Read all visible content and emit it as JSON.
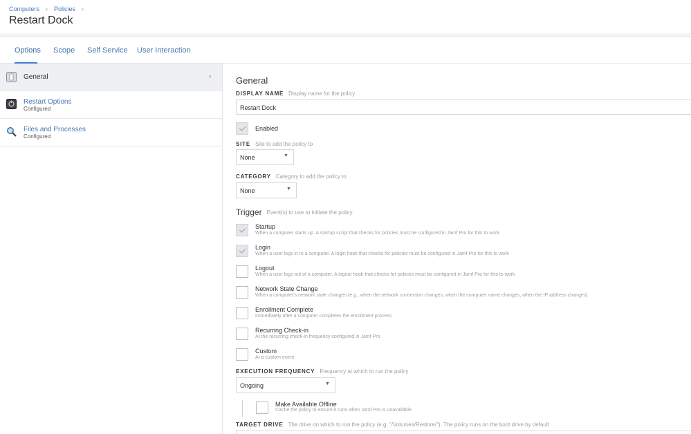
{
  "breadcrumb": [
    "Computers",
    "Policies"
  ],
  "page_title": "Restart Dock",
  "tabs": [
    "Options",
    "Scope",
    "Self Service",
    "User Interaction"
  ],
  "sidebar": {
    "items": [
      {
        "label": "General",
        "sub": ""
      },
      {
        "label": "Restart Options",
        "sub": "Configured"
      },
      {
        "label": "Files and Processes",
        "sub": "Configured"
      }
    ]
  },
  "general": {
    "heading": "General",
    "display_name_label": "DISPLAY NAME",
    "display_name_hint": "Display name for the policy",
    "display_name_value": "Restart Dock",
    "enabled_label": "Enabled",
    "site_label": "SITE",
    "site_hint": "Site to add the policy to",
    "site_value": "None",
    "category_label": "CATEGORY",
    "category_hint": "Category to add the policy to",
    "category_value": "None"
  },
  "trigger": {
    "heading": "Trigger",
    "hint": "Event(s) to use to initiate the policy",
    "items": [
      {
        "label": "Startup",
        "desc": "When a computer starts up. A startup script that checks for policies must be configured in Jamf Pro for this to work",
        "checked": true
      },
      {
        "label": "Login",
        "desc": "When a user logs in to a computer. A login hook that checks for policies must be configured in Jamf Pro for this to work",
        "checked": true
      },
      {
        "label": "Logout",
        "desc": "When a user logs out of a computer. A logout hook that checks for policies must be configured in Jamf Pro for this to work",
        "checked": false
      },
      {
        "label": "Network State Change",
        "desc": "When a computer's network state changes (e.g., when the network connection changes, when the computer name changes, when the IP address changes)",
        "checked": false
      },
      {
        "label": "Enrollment Complete",
        "desc": "Immediately after a computer completes the enrollment process",
        "checked": false
      },
      {
        "label": "Recurring Check-in",
        "desc": "At the recurring check-in frequency configured in Jamf Pro",
        "checked": false
      },
      {
        "label": "Custom",
        "desc": "At a custom event",
        "checked": false
      }
    ]
  },
  "execution": {
    "label": "EXECUTION FREQUENCY",
    "hint": "Frequency at which to run the policy",
    "value": "Ongoing",
    "offline_label": "Make Available Offline",
    "offline_desc": "Cache the policy to ensure it runs when Jamf Pro is unavailable"
  },
  "target_drive": {
    "label": "TARGET DRIVE",
    "hint": "The drive on which to run the policy (e.g. \"/Volumes/Restore/\"). The policy runs on the boot drive by default"
  },
  "icons": {
    "general": "general-icon",
    "restart": "restart-options-icon",
    "files": "magnifier-icon",
    "chevron": "chevron-right-icon",
    "dropdown": "dropdown-arrow-icon"
  },
  "colors": {
    "link": "#4a78b5",
    "accent": "#3f7fd0"
  }
}
